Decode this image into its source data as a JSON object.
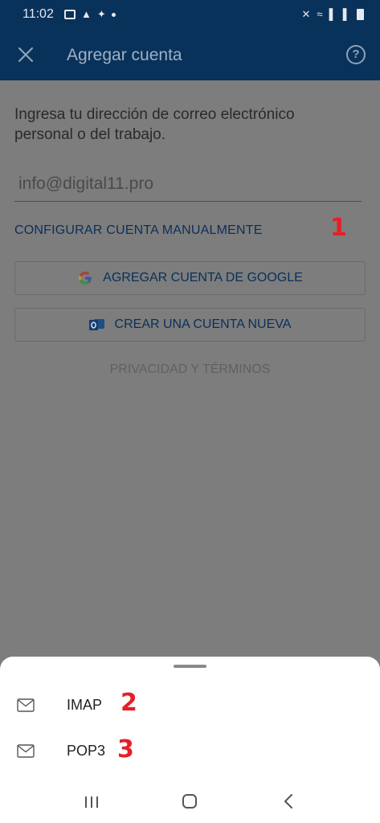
{
  "status_bar": {
    "time": "11:02",
    "left_icons": [
      "gallery-icon",
      "app-icon",
      "twitter-icon",
      "dot-icon"
    ],
    "right_icons": [
      "mute-icon",
      "wifi-icon",
      "signal-icon",
      "signal-icon",
      "battery-icon"
    ]
  },
  "app_bar": {
    "title": "Agregar cuenta",
    "close_icon": "close-icon",
    "help_icon": "help-icon",
    "help_glyph": "?",
    "background": "#08325a"
  },
  "main": {
    "intro": "Ingresa tu dirección de correo electrónico personal o del trabajo.",
    "email_value": "",
    "email_placeholder": "info@digital11.pro",
    "manual_link": "CONFIGURAR CUENTA MANUALMENTE",
    "google_button": "AGREGAR CUENTA DE GOOGLE",
    "new_account_button": "CREAR UNA CUENTA NUEVA",
    "privacy_link": "PRIVACIDAD Y TÉRMINOS"
  },
  "annotations": {
    "step1": "1",
    "step2": "2",
    "step3": "3",
    "color": "#e52027"
  },
  "sheet": {
    "items": [
      {
        "label": "IMAP",
        "icon": "mail-icon"
      },
      {
        "label": "POP3",
        "icon": "mail-icon"
      }
    ]
  },
  "nav_bar": {
    "icons": [
      "recent-apps-icon",
      "home-icon",
      "back-icon"
    ]
  }
}
